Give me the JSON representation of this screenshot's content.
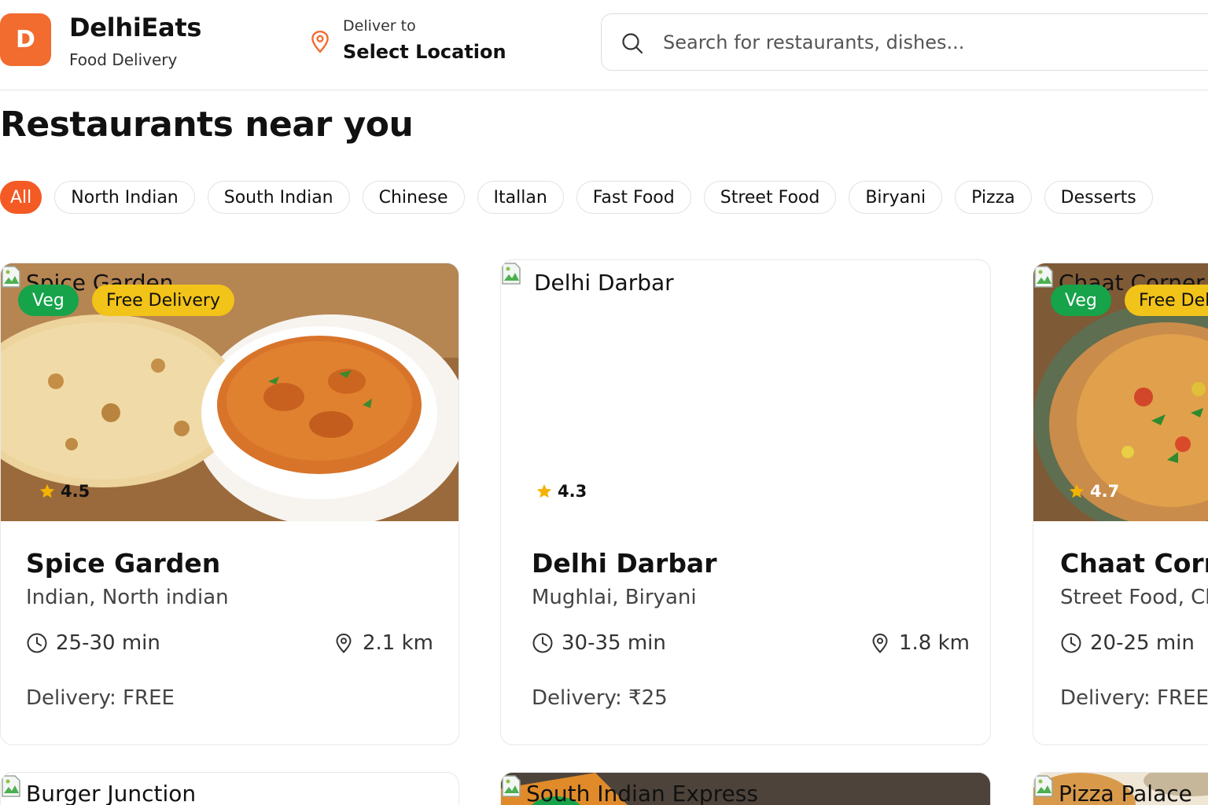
{
  "header": {
    "logo_letter": "D",
    "brand_name": "DelhiEats",
    "brand_sub": "Food Delivery",
    "deliver_label": "Deliver to",
    "location_value": "Select Location",
    "search_placeholder": "Search for restaurants, dishes..."
  },
  "page_title": "Restaurants near you",
  "filters": [
    {
      "label": "All",
      "active": true
    },
    {
      "label": "North Indian",
      "active": false
    },
    {
      "label": "South Indian",
      "active": false
    },
    {
      "label": "Chinese",
      "active": false
    },
    {
      "label": "Itallan",
      "active": false
    },
    {
      "label": "Fast Food",
      "active": false
    },
    {
      "label": "Street Food",
      "active": false
    },
    {
      "label": "Biryani",
      "active": false
    },
    {
      "label": "Pizza",
      "active": false
    },
    {
      "label": "Desserts",
      "active": false
    }
  ],
  "restaurants": [
    {
      "alt_text": "Spice Garden",
      "badge_veg": "Veg",
      "badge_free": "Free Delivery",
      "rating": "4.5",
      "name": "Spice Garden",
      "cuisine": "Indian, North indian",
      "time": "25-30 min",
      "distance": "2.1 km",
      "delivery": "Delivery: FREE"
    },
    {
      "alt_text": "Delhi Darbar",
      "rating": "4.3",
      "name": "Delhi Darbar",
      "cuisine": "Mughlai, Biryani",
      "time": "30-35 min",
      "distance": "1.8 km",
      "delivery": "Delivery: ₹25"
    },
    {
      "alt_text": "Chaat Corner",
      "badge_veg": "Veg",
      "badge_free": "Free Delivery",
      "rating": "4.7",
      "name": "Chaat Corner",
      "cuisine": "Street Food, Chaat",
      "time": "20-25 min",
      "distance": "",
      "delivery": "Delivery: FREE"
    },
    {
      "alt_text": "Burger Junction"
    },
    {
      "alt_text": "South Indian Express"
    },
    {
      "alt_text": "Pizza Palace"
    }
  ],
  "colors": {
    "brand": "#f26b2f",
    "chip_active": "#f45a24",
    "veg_badge": "#16a34a",
    "free_badge": "#f2c318",
    "star": "#f5b301"
  },
  "icons": {
    "location": "map-pin-icon",
    "search": "search-icon",
    "time": "clock-icon",
    "distance": "map-pin-icon",
    "rating": "star-icon",
    "broken_image": "broken-image-icon"
  }
}
